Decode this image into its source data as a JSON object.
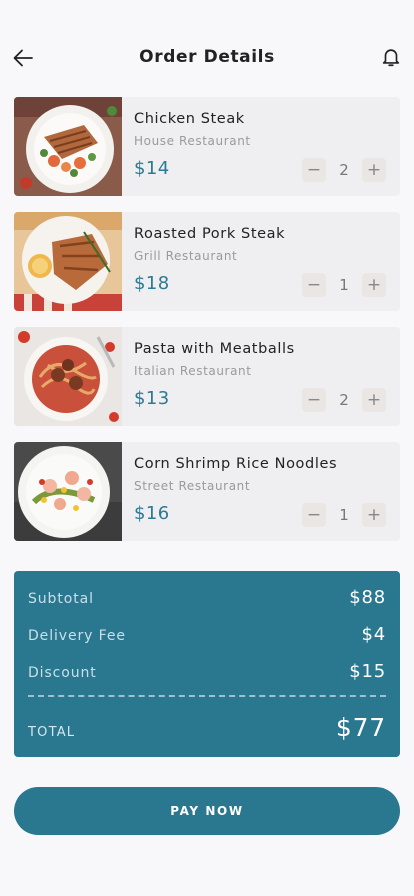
{
  "header": {
    "title": "Order Details",
    "back_icon": "arrow-left-icon",
    "notification_icon": "bell-icon"
  },
  "items": [
    {
      "name": "Chicken Steak",
      "restaurant": "House Restaurant",
      "price": "$14",
      "quantity": "2",
      "minus": "−",
      "plus": "+"
    },
    {
      "name": "Roasted Pork Steak",
      "restaurant": "Grill Restaurant",
      "price": "$18",
      "quantity": "1",
      "minus": "−",
      "plus": "+"
    },
    {
      "name": "Pasta with Meatballs",
      "restaurant": "Italian Restaurant",
      "price": "$13",
      "quantity": "2",
      "minus": "−",
      "plus": "+"
    },
    {
      "name": "Corn Shrimp Rice Noodles",
      "restaurant": "Street Restaurant",
      "price": "$16",
      "quantity": "1",
      "minus": "−",
      "plus": "+"
    }
  ],
  "summary": {
    "subtotal_label": "Subtotal",
    "subtotal_value": "$88",
    "delivery_label": "Delivery Fee",
    "delivery_value": "$4",
    "discount_label": "Discount",
    "discount_value": "$15",
    "total_label": "TOTAL",
    "total_value": "$77"
  },
  "pay_button": {
    "label": "PAY NOW"
  },
  "colors": {
    "accent": "#2a7790",
    "price": "#2c7a93",
    "background": "#f8f8fa",
    "card": "#efeff1"
  }
}
